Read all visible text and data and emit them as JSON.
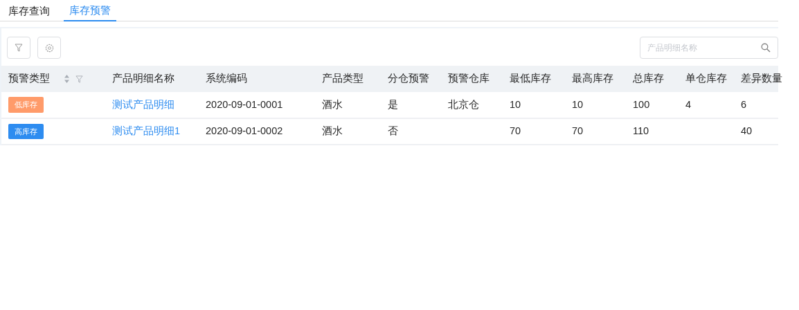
{
  "tabs": [
    {
      "label": "库存查询",
      "selected": false
    },
    {
      "label": "库存预警",
      "selected": true
    }
  ],
  "search": {
    "placeholder": "产品明细名称"
  },
  "table": {
    "columns": [
      "预警类型",
      "产品明细名称",
      "系统编码",
      "产品类型",
      "分仓预警",
      "预警仓库",
      "最低库存",
      "最高库存",
      "总库存",
      "单仓库存",
      "差异数量"
    ],
    "rows": [
      {
        "cells": [
          {
            "label": "低库存",
            "kind": "low"
          },
          "测试产品明细",
          "2020-09-01-0001",
          "酒水",
          "是",
          "北京仓",
          "10",
          "10",
          "100",
          "4",
          "6"
        ]
      },
      {
        "cells": [
          {
            "label": "高库存",
            "kind": "high"
          },
          "测试产品明细1",
          "2020-09-01-0002",
          "酒水",
          "否",
          "",
          "70",
          "70",
          "110",
          "",
          "40"
        ]
      }
    ]
  }
}
